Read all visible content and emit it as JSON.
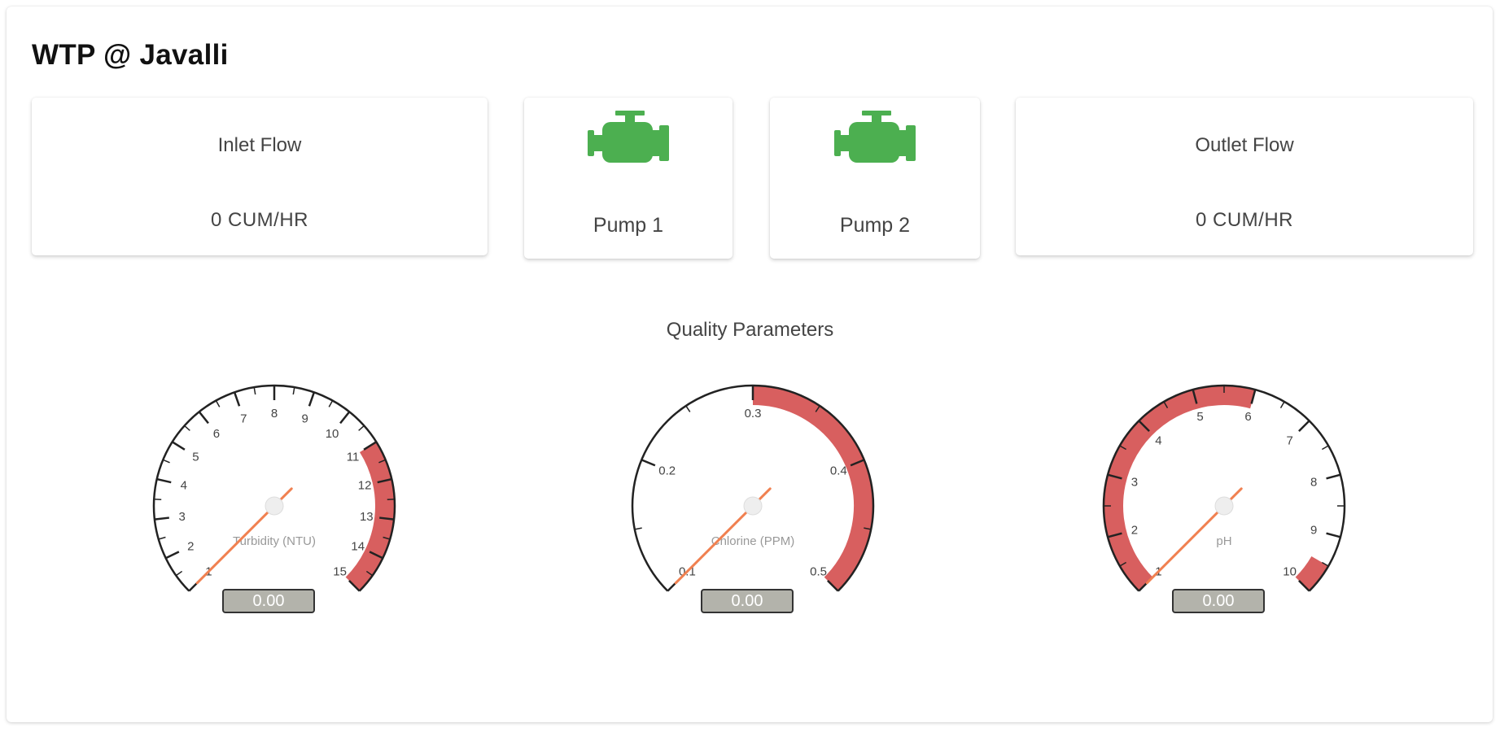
{
  "site": {
    "title": "WTP @ Javalli"
  },
  "cards": {
    "inlet": {
      "title": "Inlet Flow",
      "value": "0 CUM/HR"
    },
    "pump1": {
      "label": "Pump 1",
      "icon": "engine-icon",
      "status_color": "#4caf50"
    },
    "pump2": {
      "label": "Pump 2",
      "icon": "engine-icon",
      "status_color": "#4caf50"
    },
    "outlet": {
      "title": "Outlet Flow",
      "value": "0 CUM/HR"
    }
  },
  "quality": {
    "heading": "Quality Parameters",
    "accent_color": "#d85f5f",
    "needle_color": "#f08050",
    "gauges": [
      {
        "label": "Turbidity (NTU)",
        "readout": "0.00",
        "value": 0,
        "min": 1,
        "max": 15,
        "major_labels": [
          "1",
          "2",
          "3",
          "4",
          "5",
          "6",
          "7",
          "8",
          "9",
          "10",
          "11",
          "12",
          "13",
          "14",
          "15"
        ],
        "major_values": [
          1,
          2,
          3,
          4,
          5,
          6,
          7,
          8,
          9,
          10,
          11,
          12,
          13,
          14,
          15
        ],
        "minor_per_major": 1,
        "red_ranges": [
          [
            11,
            15
          ]
        ]
      },
      {
        "label": "Chlorine (PPM)",
        "readout": "0.00",
        "value": 0,
        "min": 0.1,
        "max": 0.5,
        "major_labels": [
          "0.1",
          "0.2",
          "0.3",
          "0.4",
          "0.5"
        ],
        "major_values": [
          0.1,
          0.2,
          0.3,
          0.4,
          0.5
        ],
        "minor_per_major": 1,
        "red_ranges": [
          [
            0.3,
            0.5
          ]
        ]
      },
      {
        "label": "pH",
        "readout": "0.00",
        "value": 0,
        "min": 1,
        "max": 10,
        "major_labels": [
          "1",
          "2",
          "3",
          "4",
          "5",
          "6",
          "7",
          "8",
          "9",
          "10"
        ],
        "major_values": [
          1,
          2,
          3,
          4,
          5,
          6,
          7,
          8,
          9,
          10
        ],
        "minor_per_major": 1,
        "red_ranges": [
          [
            1,
            6
          ],
          [
            9.5,
            10
          ]
        ]
      }
    ]
  }
}
